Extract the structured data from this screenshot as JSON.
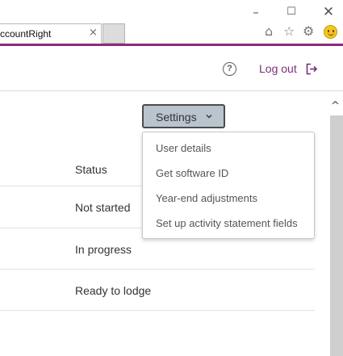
{
  "browser": {
    "tab_title": "ccountRight",
    "tab_close": "×",
    "window_controls": {
      "minimize": "–",
      "maximize": "☐",
      "close": "✕"
    },
    "toolbar_icons": [
      "home-icon",
      "star-icon",
      "gear-icon",
      "smiley-icon"
    ],
    "accent_color": "#8a2b7a"
  },
  "header": {
    "help_icon": "?",
    "logout_label": "Log out",
    "logout_color": "#7a2d7c"
  },
  "settings_button": {
    "label": "Settings",
    "background": "#b9c4ce"
  },
  "settings_menu": {
    "items": [
      "User details",
      "Get software ID",
      "Year-end adjustments",
      "Set up activity statement fields"
    ]
  },
  "table": {
    "header": "Status",
    "rows": [
      "Not started",
      "In progress",
      "Ready to lodge"
    ]
  },
  "scrollbar": {
    "up_arrow": "^"
  }
}
